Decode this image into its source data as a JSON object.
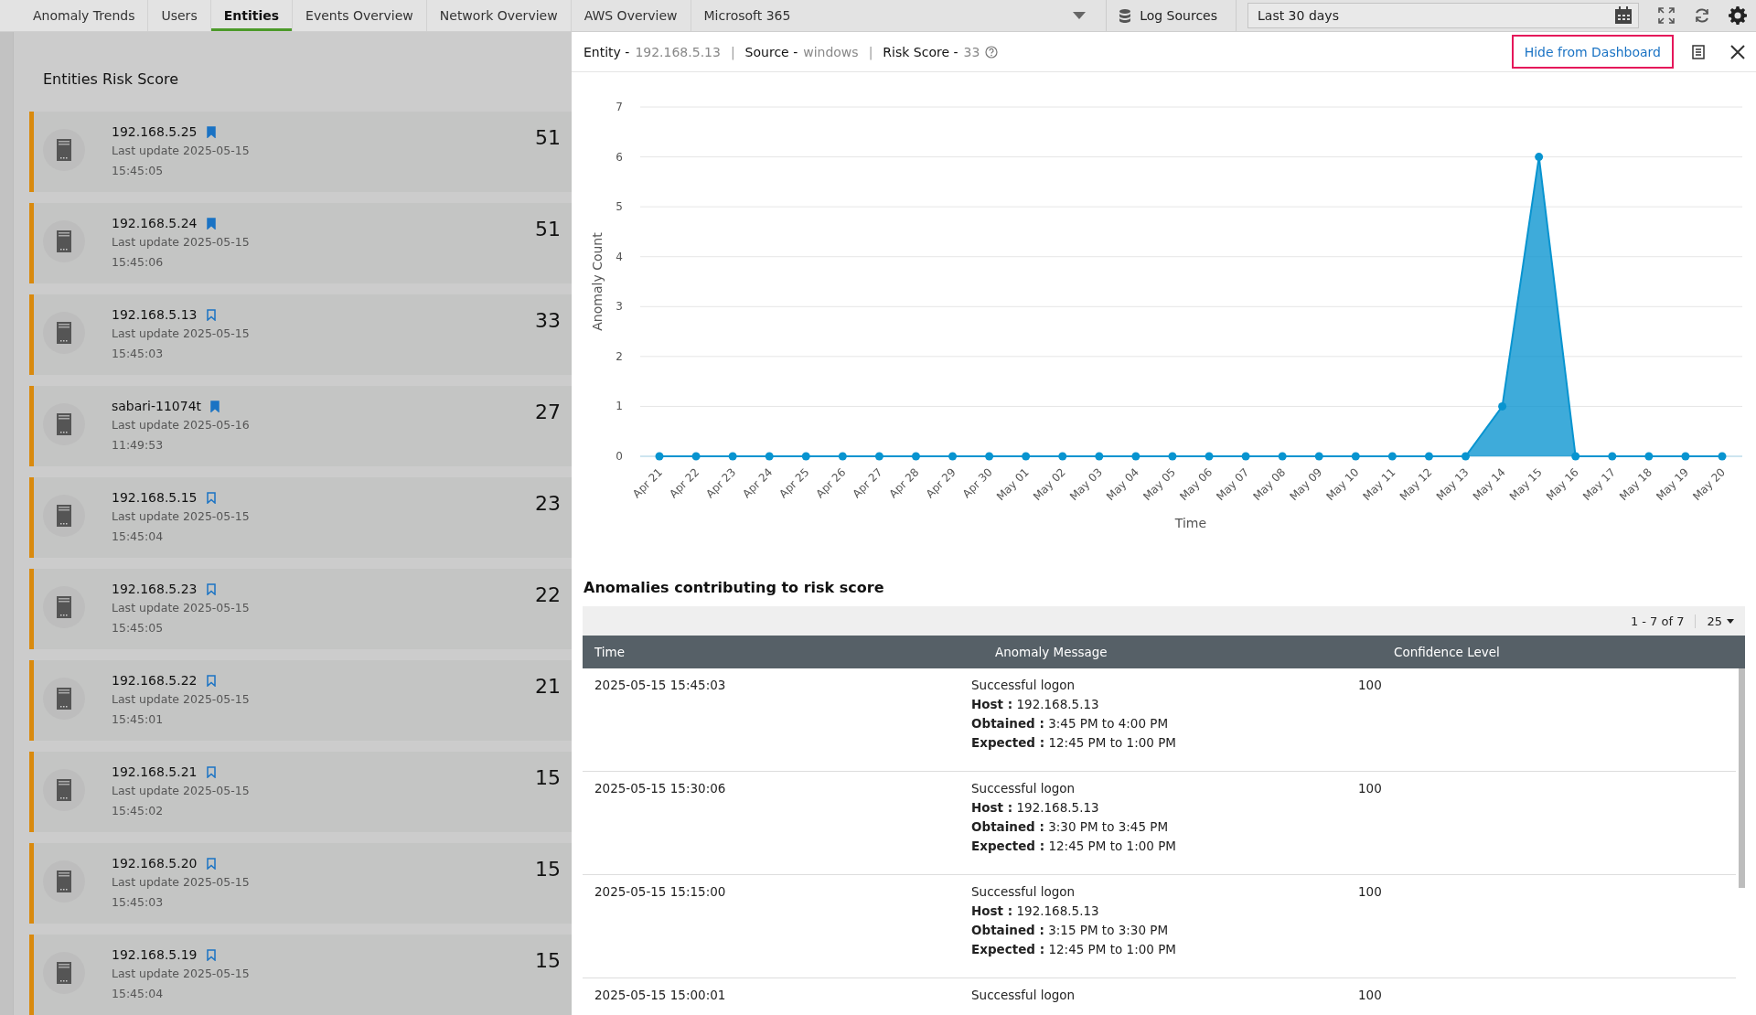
{
  "tabs": [
    {
      "label": "Anomaly Trends",
      "selected": false
    },
    {
      "label": "Users",
      "selected": false
    },
    {
      "label": "Entities",
      "selected": true
    },
    {
      "label": "Events Overview",
      "selected": false
    },
    {
      "label": "Network Overview",
      "selected": false
    },
    {
      "label": "AWS Overview",
      "selected": false
    },
    {
      "label": "Microsoft 365",
      "selected": false
    }
  ],
  "toolbar": {
    "log_sources": "Log Sources",
    "date_range": "Last 30 days"
  },
  "entities_panel": {
    "title": "Entities Risk Score",
    "items": [
      {
        "name": "192.168.5.25",
        "bookmarked": true,
        "updated": "Last update 2025-05-15",
        "time": "15:45:05",
        "score": "51"
      },
      {
        "name": "192.168.5.24",
        "bookmarked": true,
        "updated": "Last update 2025-05-15",
        "time": "15:45:06",
        "score": "51"
      },
      {
        "name": "192.168.5.13",
        "bookmarked": false,
        "updated": "Last update 2025-05-15",
        "time": "15:45:03",
        "score": "33"
      },
      {
        "name": "sabari-11074t",
        "bookmarked": true,
        "updated": "Last update 2025-05-16",
        "time": "11:49:53",
        "score": "27"
      },
      {
        "name": "192.168.5.15",
        "bookmarked": false,
        "updated": "Last update 2025-05-15",
        "time": "15:45:04",
        "score": "23"
      },
      {
        "name": "192.168.5.23",
        "bookmarked": false,
        "updated": "Last update 2025-05-15",
        "time": "15:45:05",
        "score": "22"
      },
      {
        "name": "192.168.5.22",
        "bookmarked": false,
        "updated": "Last update 2025-05-15",
        "time": "15:45:01",
        "score": "21"
      },
      {
        "name": "192.168.5.21",
        "bookmarked": false,
        "updated": "Last update 2025-05-15",
        "time": "15:45:02",
        "score": "15"
      },
      {
        "name": "192.168.5.20",
        "bookmarked": false,
        "updated": "Last update 2025-05-15",
        "time": "15:45:03",
        "score": "15"
      },
      {
        "name": "192.168.5.19",
        "bookmarked": false,
        "updated": "Last update 2025-05-15",
        "time": "15:45:04",
        "score": "15"
      }
    ]
  },
  "detail": {
    "header": [
      {
        "kind": "field",
        "label": "Entity -",
        "value": "192.168.5.13"
      },
      {
        "kind": "separator",
        "text": "|"
      },
      {
        "kind": "field",
        "label": "Source -",
        "value": "windows"
      },
      {
        "kind": "separator",
        "text": "|"
      },
      {
        "kind": "field",
        "label": "Risk Score -",
        "value": "33"
      }
    ],
    "hide_button": "Hide from Dashboard",
    "chart_data": {
      "type": "area",
      "xlabel": "Time",
      "ylabel": "Anomaly Count",
      "categories": [
        "Apr 21",
        "Apr 22",
        "Apr 23",
        "Apr 24",
        "Apr 25",
        "Apr 26",
        "Apr 27",
        "Apr 28",
        "Apr 29",
        "Apr 30",
        "May 01",
        "May 02",
        "May 03",
        "May 04",
        "May 05",
        "May 06",
        "May 07",
        "May 08",
        "May 09",
        "May 10",
        "May 11",
        "May 12",
        "May 13",
        "May 14",
        "May 15",
        "May 16",
        "May 17",
        "May 18",
        "May 19",
        "May 20"
      ],
      "grid": true,
      "series": [
        {
          "color": "#0894d0",
          "values": [
            0,
            0,
            0,
            0,
            0,
            0,
            0,
            0,
            0,
            0,
            0,
            0,
            0,
            0,
            0,
            0,
            0,
            0,
            0,
            0,
            0,
            0,
            0,
            1,
            6,
            0,
            0,
            0,
            0,
            0
          ]
        }
      ],
      "ylim": [
        0,
        7
      ],
      "yticks": [
        0,
        1,
        2,
        3,
        4,
        5,
        6,
        7
      ]
    },
    "table_title": "Anomalies contributing to risk score",
    "pager": {
      "range": "1 - 7 of 7",
      "page_size": "25"
    },
    "columns": [
      "Time",
      "Anomaly Message",
      "Confidence Level"
    ],
    "rows": [
      {
        "time": "2025-05-15 15:45:03",
        "message": "Successful logon",
        "details": [
          "**Host :** 192.168.5.13",
          "**Obtained :** 3:45 PM to 4:00 PM",
          "**Expected :** 12:45 PM to 1:00 PM"
        ],
        "confidence": "100"
      },
      {
        "time": "2025-05-15 15:30:06",
        "message": "Successful logon",
        "details": [
          "**Host :** 192.168.5.13",
          "**Obtained :** 3:30 PM to 3:45 PM",
          "**Expected :** 12:45 PM to 1:00 PM"
        ],
        "confidence": "100"
      },
      {
        "time": "2025-05-15 15:15:00",
        "message": "Successful logon",
        "details": [
          "**Host :** 192.168.5.13",
          "**Obtained :** 3:15 PM to 3:30 PM",
          "**Expected :** 12:45 PM to 1:00 PM"
        ],
        "confidence": "100"
      },
      {
        "time": "2025-05-15 15:00:01",
        "message": "Successful logon",
        "confidence": "100"
      }
    ]
  }
}
